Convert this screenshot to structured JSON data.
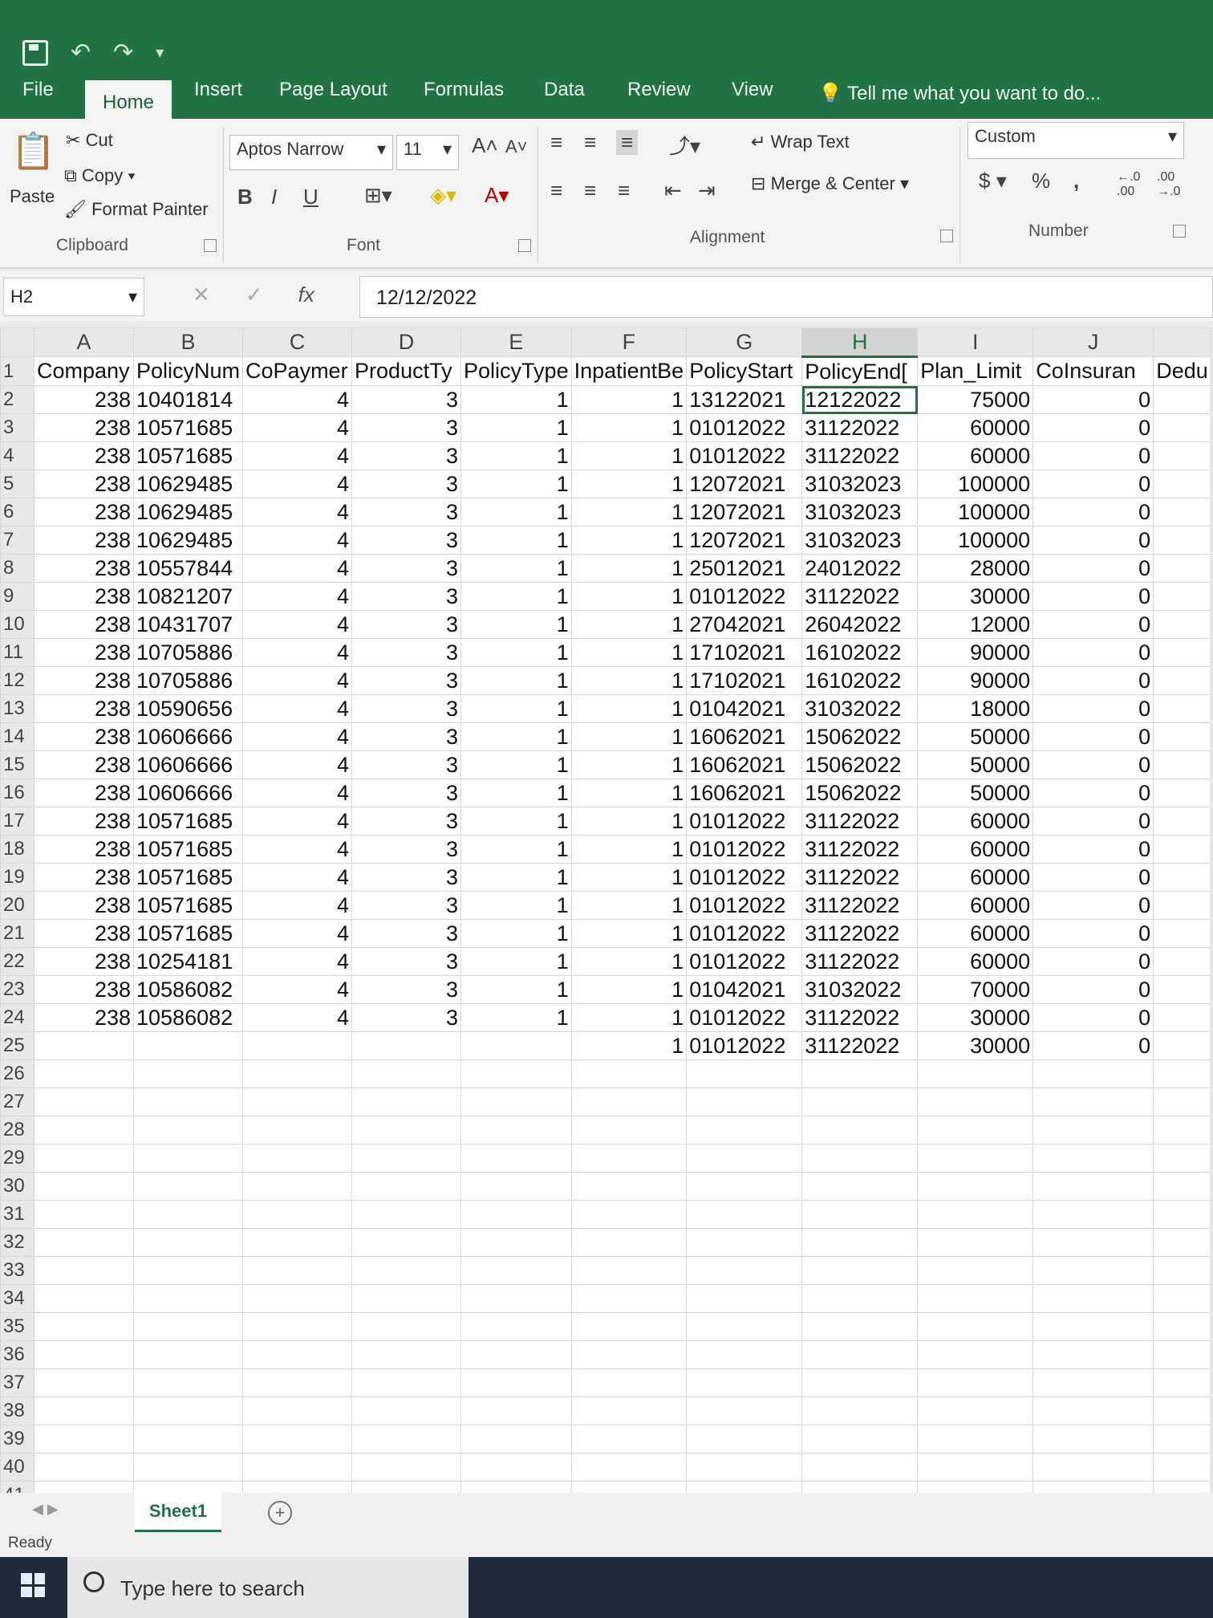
{
  "ribbon": {
    "tabs": [
      "File",
      "Home",
      "Insert",
      "Page Layout",
      "Formulas",
      "Data",
      "Review",
      "View"
    ],
    "tell_me": "Tell me what you want to do...",
    "clipboard": {
      "cut": "Cut",
      "copy": "Copy",
      "format_painter": "Format Painter",
      "paste": "Paste",
      "group": "Clipboard"
    },
    "font": {
      "name": "Aptos Narrow",
      "size": "11",
      "bold": "B",
      "italic": "I",
      "underline": "U",
      "group": "Font"
    },
    "alignment": {
      "wrap_text": "Wrap Text",
      "merge_center": "Merge & Center",
      "group": "Alignment"
    },
    "number": {
      "format": "Custom",
      "currency": "$",
      "percent": "%",
      "comma": ",",
      "group": "Number"
    }
  },
  "formula_bar": {
    "name_box": "H2",
    "fx": "fx",
    "value": "12/12/2022"
  },
  "columns": [
    "A",
    "B",
    "C",
    "D",
    "E",
    "F",
    "G",
    "H",
    "I",
    "J"
  ],
  "headers": [
    "Company",
    "PolicyNum",
    "CoPaymer",
    "ProductTy",
    "PolicyType",
    "InpatientBe",
    "PolicyStart",
    "PolicyEnd[",
    "Plan_Limit",
    "CoInsuran",
    "Dedu"
  ],
  "rows": [
    [
      "238",
      "10401814",
      "4",
      "3",
      "1",
      "1",
      "13122021",
      "12122022",
      "75000",
      "0"
    ],
    [
      "238",
      "10571685",
      "4",
      "3",
      "1",
      "1",
      "01012022",
      "31122022",
      "60000",
      "0"
    ],
    [
      "238",
      "10571685",
      "4",
      "3",
      "1",
      "1",
      "01012022",
      "31122022",
      "60000",
      "0"
    ],
    [
      "238",
      "10629485",
      "4",
      "3",
      "1",
      "1",
      "12072021",
      "31032023",
      "100000",
      "0"
    ],
    [
      "238",
      "10629485",
      "4",
      "3",
      "1",
      "1",
      "12072021",
      "31032023",
      "100000",
      "0"
    ],
    [
      "238",
      "10629485",
      "4",
      "3",
      "1",
      "1",
      "12072021",
      "31032023",
      "100000",
      "0"
    ],
    [
      "238",
      "10557844",
      "4",
      "3",
      "1",
      "1",
      "25012021",
      "24012022",
      "28000",
      "0"
    ],
    [
      "238",
      "10821207",
      "4",
      "3",
      "1",
      "1",
      "01012022",
      "31122022",
      "30000",
      "0"
    ],
    [
      "238",
      "10431707",
      "4",
      "3",
      "1",
      "1",
      "27042021",
      "26042022",
      "12000",
      "0"
    ],
    [
      "238",
      "10705886",
      "4",
      "3",
      "1",
      "1",
      "17102021",
      "16102022",
      "90000",
      "0"
    ],
    [
      "238",
      "10705886",
      "4",
      "3",
      "1",
      "1",
      "17102021",
      "16102022",
      "90000",
      "0"
    ],
    [
      "238",
      "10590656",
      "4",
      "3",
      "1",
      "1",
      "01042021",
      "31032022",
      "18000",
      "0"
    ],
    [
      "238",
      "10606666",
      "4",
      "3",
      "1",
      "1",
      "16062021",
      "15062022",
      "50000",
      "0"
    ],
    [
      "238",
      "10606666",
      "4",
      "3",
      "1",
      "1",
      "16062021",
      "15062022",
      "50000",
      "0"
    ],
    [
      "238",
      "10606666",
      "4",
      "3",
      "1",
      "1",
      "16062021",
      "15062022",
      "50000",
      "0"
    ],
    [
      "238",
      "10571685",
      "4",
      "3",
      "1",
      "1",
      "01012022",
      "31122022",
      "60000",
      "0"
    ],
    [
      "238",
      "10571685",
      "4",
      "3",
      "1",
      "1",
      "01012022",
      "31122022",
      "60000",
      "0"
    ],
    [
      "238",
      "10571685",
      "4",
      "3",
      "1",
      "1",
      "01012022",
      "31122022",
      "60000",
      "0"
    ],
    [
      "238",
      "10571685",
      "4",
      "3",
      "1",
      "1",
      "01012022",
      "31122022",
      "60000",
      "0"
    ],
    [
      "238",
      "10571685",
      "4",
      "3",
      "1",
      "1",
      "01012022",
      "31122022",
      "60000",
      "0"
    ],
    [
      "238",
      "10254181",
      "4",
      "3",
      "1",
      "1",
      "01012022",
      "31122022",
      "60000",
      "0"
    ],
    [
      "238",
      "10586082",
      "4",
      "3",
      "1",
      "1",
      "01042021",
      "31032022",
      "70000",
      "0"
    ],
    [
      "238",
      "10586082",
      "4",
      "3",
      "1",
      "1",
      "01012022",
      "31122022",
      "30000",
      "0"
    ],
    [
      "",
      "",
      "",
      "",
      "",
      "1",
      "01012022",
      "31122022",
      "30000",
      "0"
    ]
  ],
  "empty_row_count": 16,
  "sheet_tab": "Sheet1",
  "status": "Ready",
  "taskbar": {
    "search_placeholder": "Type here to search"
  }
}
